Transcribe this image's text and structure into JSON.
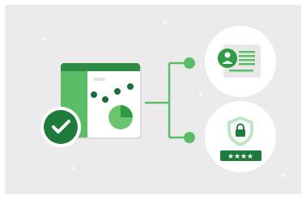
{
  "colors": {
    "page": "#ffffff",
    "panel": "#ebebeb",
    "sparkle": "#f7f7f7",
    "card": "#ffffff",
    "card_shadow": "#dcdcdc",
    "header_green": "#2e8b45",
    "side_green": "#5cbd67",
    "dark_green": "#1e7b3b",
    "dot_green": "#1e6f35",
    "pie_light": "#6cc46f",
    "pie_dark": "#2e9b45",
    "connector": "#5cbd67",
    "skeleton": "#e2e2e2",
    "id_card": "#e8e8e8",
    "id_lines": "#5cbd67",
    "avatar": "#2e9b45",
    "shield_light": "#bfe6c2",
    "shield_dark": "#2e9b45",
    "password_bar": "#1e7b3b",
    "password_star": "#ffffff"
  },
  "icons": {
    "dashboard": "dashboard-window-icon",
    "check": "check-circle-icon",
    "profile": "profile-card-icon",
    "lock": "shield-lock-icon",
    "password": "password-field-icon"
  }
}
